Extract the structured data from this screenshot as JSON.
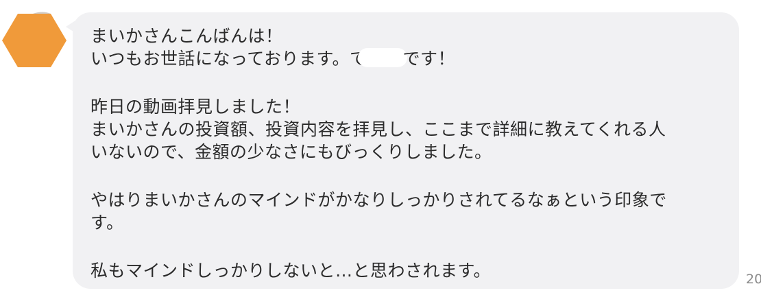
{
  "avatar": {
    "icon": "hexagon-avatar-icon",
    "fill_color": "#F09A3A"
  },
  "message": {
    "bubble_color": "#F1F1F3",
    "text_color": "#2B2B2B",
    "line_1": "まいかさんこんばんは！",
    "line_2_before": "いつもお世話になっております。",
    "line_2_visible_char": "て",
    "line_2_after": "です！",
    "line_3": "昨日の動画拝見しました！",
    "line_4": "まいかさんの投資額、投資内容を拝見し、ここまで詳細に教えてくれる人",
    "line_5": "いないので、金額の少なさにもびっくりしました。",
    "line_6": "やはりまいかさんのマインドがかなりしっかりされてるなぁという印象で",
    "line_7": "す。",
    "line_8": "私もマインドしっかりしないと…と思わされます。"
  },
  "timestamp": {
    "text": "20"
  }
}
